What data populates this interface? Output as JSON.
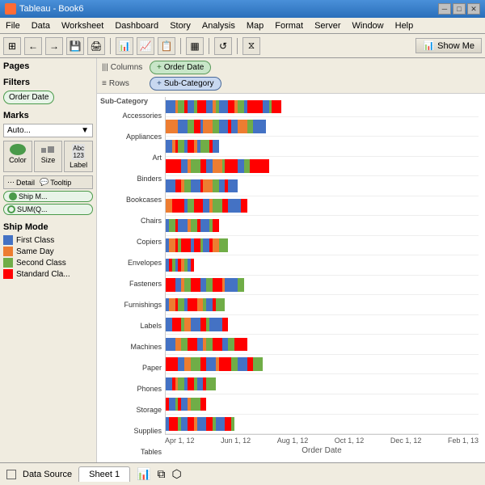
{
  "titleBar": {
    "title": "Tableau - Book6",
    "minimize": "─",
    "maximize": "□",
    "close": "✕"
  },
  "menuBar": {
    "items": [
      "File",
      "Data",
      "Worksheet",
      "Dashboard",
      "Story",
      "Analysis",
      "Map",
      "Format",
      "Server",
      "Window",
      "Help"
    ]
  },
  "toolbar": {
    "showMe": "Show Me",
    "showMeIcon": "📊"
  },
  "leftPanel": {
    "pagesLabel": "Pages",
    "filtersLabel": "Filters",
    "filterPill": "Order Date",
    "marksLabel": "Marks",
    "marksDropdown": "Auto...",
    "colorLabel": "Color",
    "sizeLabel": "Size",
    "labelLabel": "Label",
    "detailLabel": "Detail",
    "tooltipLabel": "Tooltip",
    "shipMPill": "Ship M...",
    "sumPill": "SUM(Q...",
    "shipModeLabel": "Ship Mode",
    "legendItems": [
      {
        "label": "First Class",
        "color": "blue"
      },
      {
        "label": "Same Day",
        "color": "orange"
      },
      {
        "label": "Second Class",
        "color": "green"
      },
      {
        "label": "Standard Cla...",
        "color": "red"
      }
    ]
  },
  "shelves": {
    "columnsLabel": "Columns",
    "rowsLabel": "Rows",
    "columnPill": "Order Date",
    "rowPill": "Sub-Category",
    "columnsIcon": "|||",
    "rowsIcon": "≡"
  },
  "chart": {
    "yAxisHeader": "Sub-Category",
    "categories": [
      "Accessories",
      "Appliances",
      "Art",
      "Binders",
      "Bookcases",
      "Chairs",
      "Copiers",
      "Envelopes",
      "Fasteners",
      "Furnishings",
      "Labels",
      "Machines",
      "Paper",
      "Phones",
      "Storage",
      "Supplies",
      "Tables"
    ],
    "xLabels": [
      "Apr 1, 12",
      "Jun 1, 12",
      "Aug 1, 12",
      "Oct 1, 12",
      "Dec 1, 12",
      "Feb 1, 13"
    ],
    "xTitle": "Order Date"
  },
  "statusBar": {
    "dataSource": "Data Source",
    "sheet1": "Sheet 1"
  }
}
